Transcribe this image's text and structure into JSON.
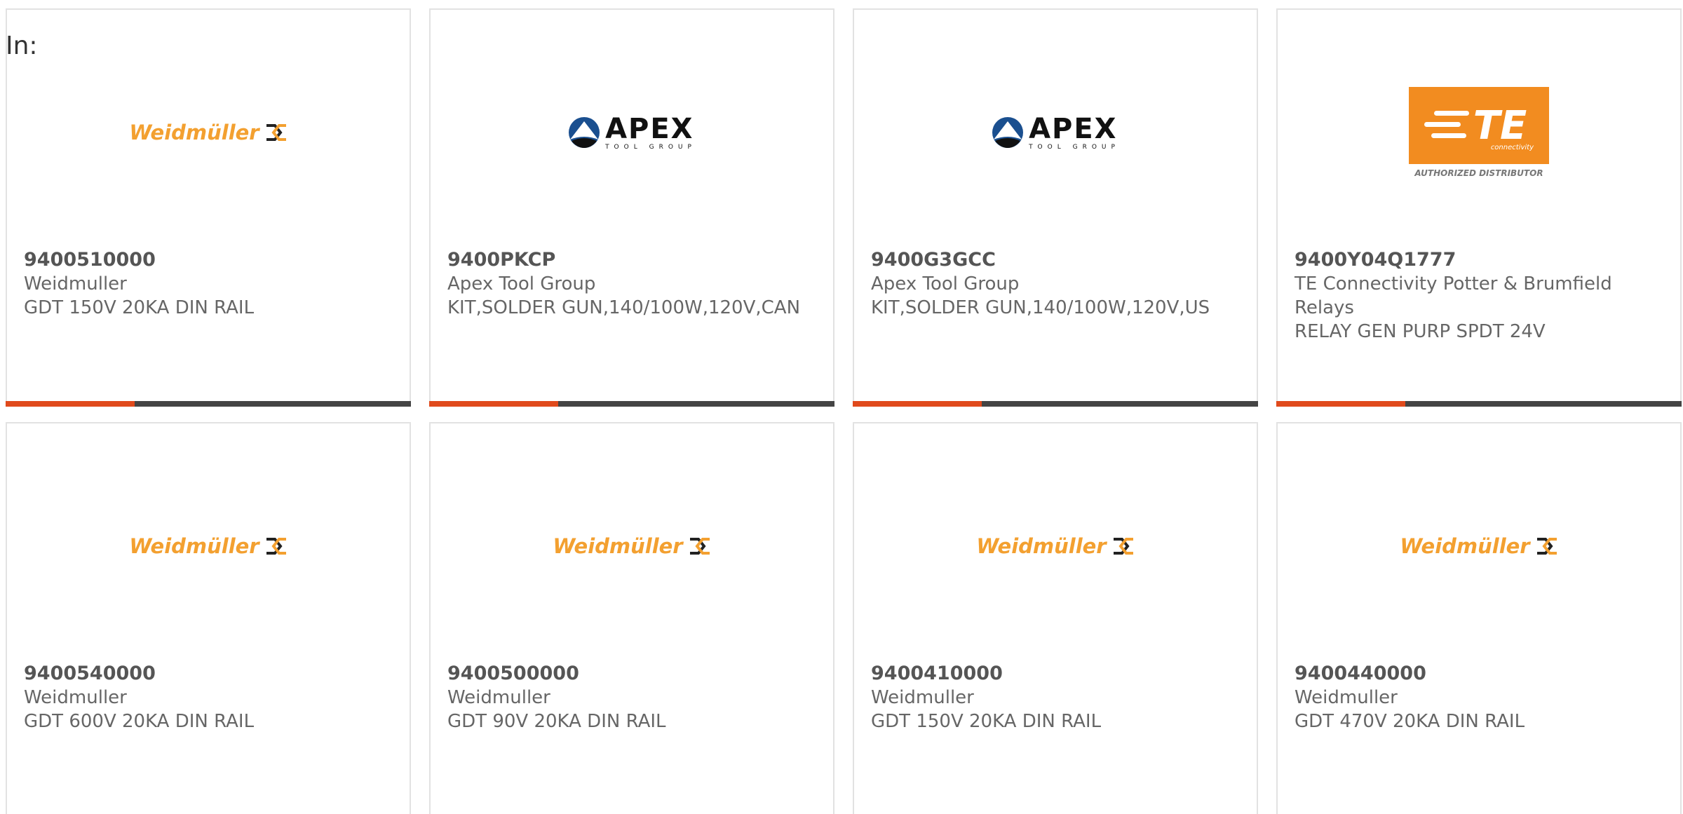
{
  "header": {
    "in_label": "In:"
  },
  "logos": {
    "weidmuller": "Weidmüller",
    "apex_main": "APEX",
    "apex_sub": "TOOL GROUP",
    "te_main": "TE",
    "te_sub": "connectivity",
    "te_authorized": "AUTHORIZED DISTRIBUTOR"
  },
  "colors": {
    "accent_bar": "#e04a1c",
    "dark_bar": "#444444",
    "weidmuller_orange": "#f3a030",
    "te_orange": "#f28c20"
  },
  "products": [
    {
      "logo": "weidmuller",
      "part": "9400510000",
      "manufacturer": "Weidmuller",
      "description": "GDT 150V 20KA DIN RAIL"
    },
    {
      "logo": "apex",
      "part": "9400PKCP",
      "manufacturer": "Apex Tool Group",
      "description": "KIT,SOLDER GUN,140/100W,120V,CAN"
    },
    {
      "logo": "apex",
      "part": "9400G3GCC",
      "manufacturer": "Apex Tool Group",
      "description": "KIT,SOLDER GUN,140/100W,120V,US"
    },
    {
      "logo": "te",
      "part": "9400Y04Q1777",
      "manufacturer": "TE Connectivity Potter & Brumfield Relays",
      "description": "RELAY GEN PURP SPDT 24V"
    },
    {
      "logo": "weidmuller",
      "part": "9400540000",
      "manufacturer": "Weidmuller",
      "description": "GDT 600V 20KA DIN RAIL"
    },
    {
      "logo": "weidmuller",
      "part": "9400500000",
      "manufacturer": "Weidmuller",
      "description": "GDT 90V 20KA DIN RAIL"
    },
    {
      "logo": "weidmuller",
      "part": "9400410000",
      "manufacturer": "Weidmuller",
      "description": "GDT 150V 20KA DIN RAIL"
    },
    {
      "logo": "weidmuller",
      "part": "9400440000",
      "manufacturer": "Weidmuller",
      "description": "GDT 470V 20KA DIN RAIL"
    }
  ]
}
